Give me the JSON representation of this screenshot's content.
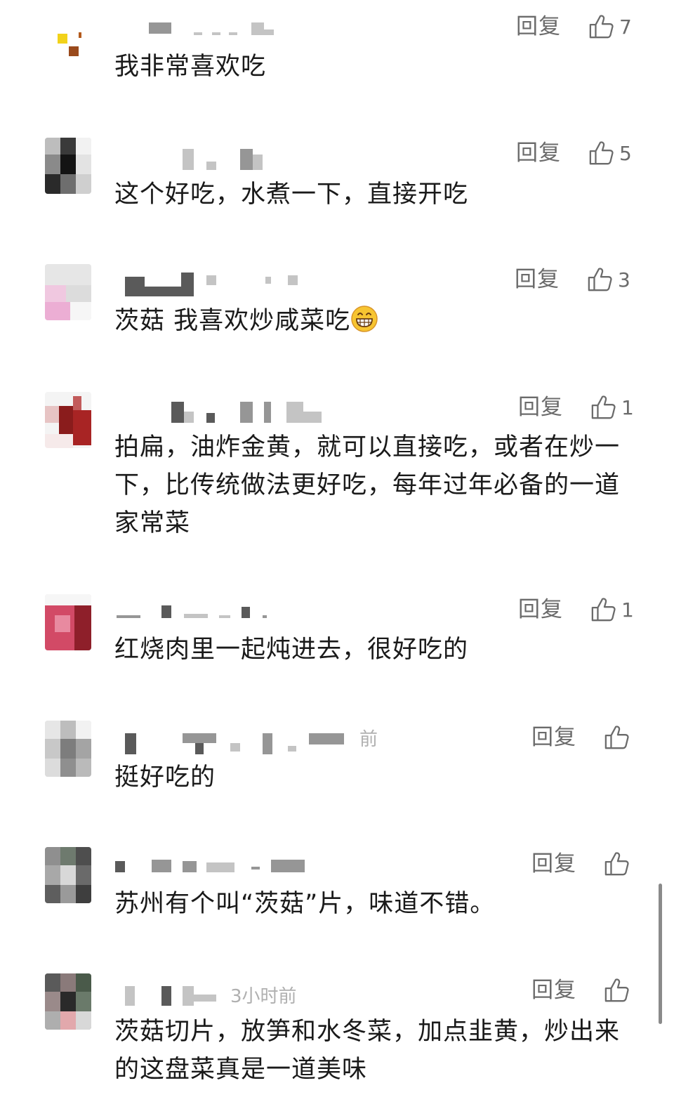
{
  "reply_label": "回复",
  "comments": [
    {
      "text": "我非常喜欢吃",
      "likes": "7",
      "time": ""
    },
    {
      "text": "这个好吃，水煮一下，直接开吃",
      "likes": "5",
      "time": ""
    },
    {
      "text": "茨菇 我喜欢炒咸菜吃",
      "likes": "3",
      "time": "",
      "emoji": "grinning-face"
    },
    {
      "text": "拍扁，油炸金黄，就可以直接吃，或者在炒一下，比传统做法更好吃，每年过年必备的一道家常菜",
      "likes": "1",
      "time": ""
    },
    {
      "text": "红烧肉里一起炖进去，很好吃的",
      "likes": "1",
      "time": ""
    },
    {
      "text": "挺好吃的",
      "likes": "",
      "time": "前"
    },
    {
      "text": "苏州有个叫“茨菇”片，味道不错。",
      "likes": "",
      "time": ""
    },
    {
      "text": "茨菇切片，放笋和水冬菜，加点韭黄，炒出来的这盘菜真是一道美味",
      "likes": "",
      "time": "3小时前"
    }
  ],
  "icons": {
    "like": "thumbs-up-icon",
    "emoji": "grinning-face-icon"
  },
  "colors": {
    "text": "#1a1a1a",
    "meta": "#6b6b6b",
    "blur": "#c4c4c4"
  }
}
